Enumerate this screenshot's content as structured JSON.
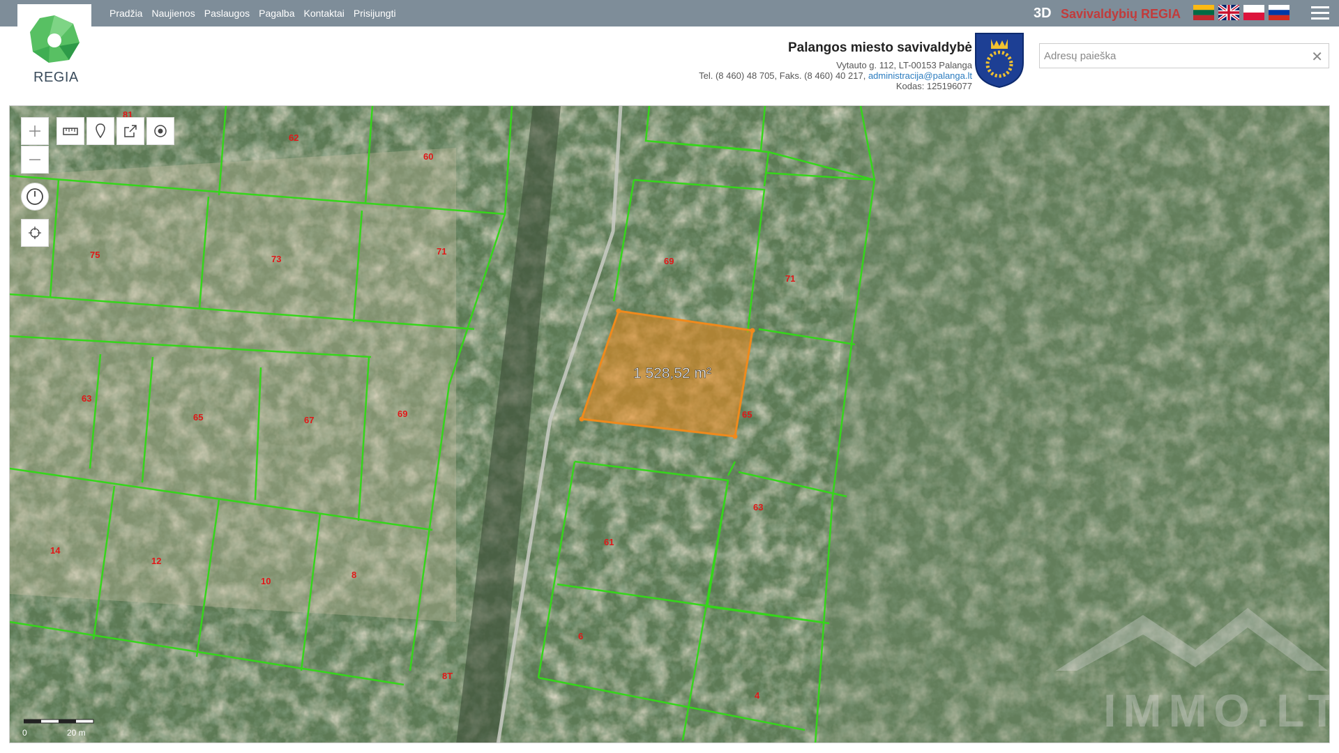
{
  "nav": {
    "items": [
      "Pradžia",
      "Naujienos",
      "Paslaugos",
      "Pagalba",
      "Kontaktai",
      "Prisijungti"
    ]
  },
  "brand": {
    "three_d": "3D",
    "name": "Savivaldybių REGIA",
    "logo_text": "REGIA"
  },
  "flags": [
    "lt-flag",
    "uk-flag",
    "pl-flag",
    "ru-flag"
  ],
  "municipality": {
    "name": "Palangos miesto savivaldybė",
    "address": "Vytauto g. 112, LT-00153 Palanga",
    "phone_prefix": "Tel. (8 460) 48 705, Faks. (8 460) 40 217, ",
    "email": "administracija@palanga.lt",
    "code": "Kodas: 125196077"
  },
  "search": {
    "placeholder": "Adresų paieška",
    "clear": "✕"
  },
  "map": {
    "measurement": "1 528,52 m²",
    "parcel_labels": [
      "81",
      "62",
      "60",
      "75",
      "73",
      "71",
      "69",
      "71",
      "63",
      "65",
      "67",
      "69",
      "65",
      "63",
      "14",
      "12",
      "10",
      "8",
      "61",
      "6",
      "4",
      "8T"
    ],
    "scale": {
      "zero": "0",
      "distance": "20 m"
    },
    "watermark": "IMMO.LT"
  },
  "colors": {
    "topbar": "#7e8d99",
    "brand_red": "#c23b3b",
    "parcel_line": "#35d61a",
    "selection": "#f08a1c",
    "label_red": "#e01818"
  }
}
